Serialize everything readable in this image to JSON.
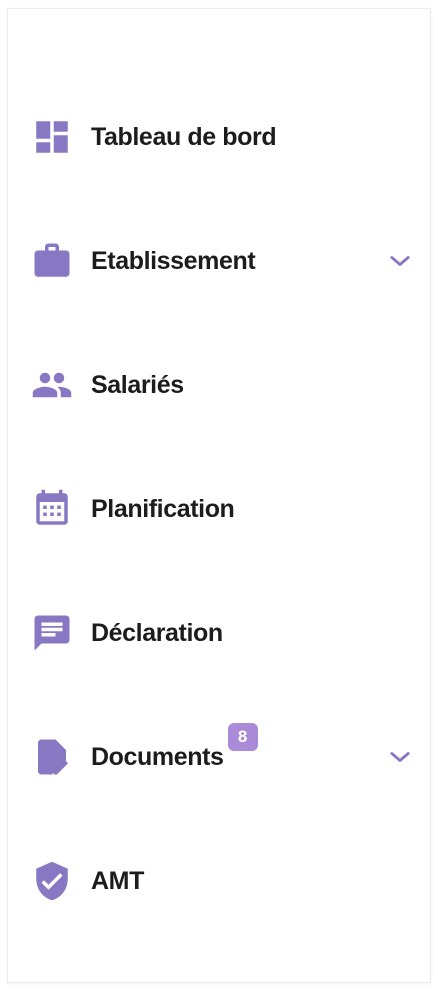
{
  "theme": {
    "icon_color": "#8878c3",
    "text_color": "#1c1c1c",
    "badge_color": "#a98bd8"
  },
  "sidebar": {
    "items": [
      {
        "label": "Tableau de bord",
        "icon": "dashboard-icon",
        "expandable": false
      },
      {
        "label": "Etablissement",
        "icon": "briefcase-icon",
        "expandable": true
      },
      {
        "label": "Salariés",
        "icon": "people-icon",
        "expandable": false
      },
      {
        "label": "Planification",
        "icon": "calendar-icon",
        "expandable": false
      },
      {
        "label": "Déclaration",
        "icon": "chat-icon",
        "expandable": false
      },
      {
        "label": "Documents",
        "icon": "document-edit-icon",
        "expandable": true,
        "badge": "8"
      },
      {
        "label": "AMT",
        "icon": "shield-check-icon",
        "expandable": false
      }
    ]
  }
}
